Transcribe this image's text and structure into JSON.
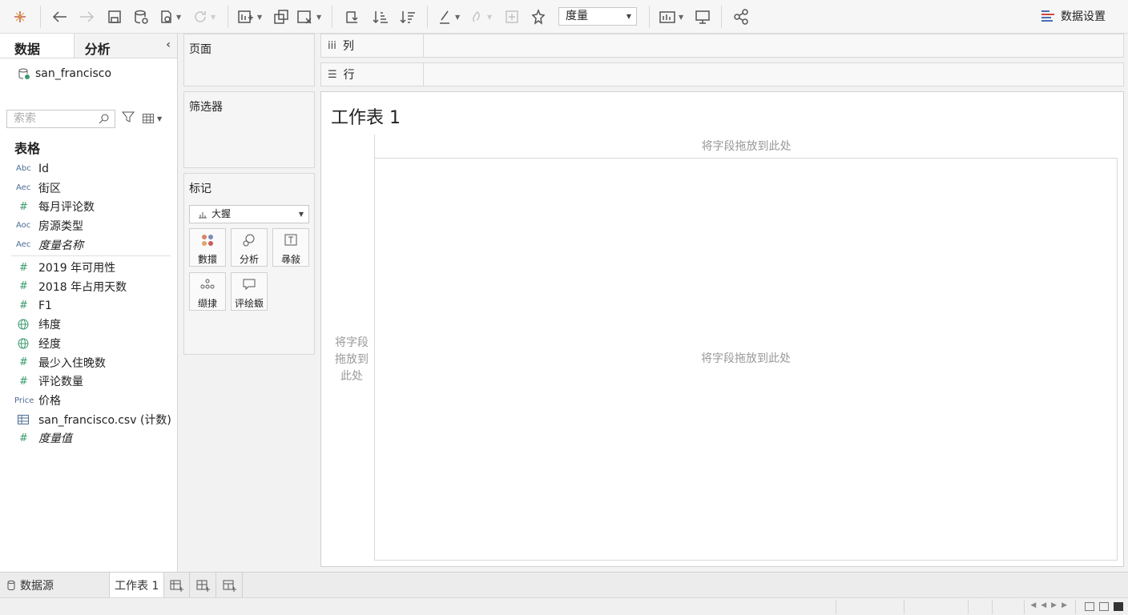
{
  "toolbar": {
    "measure_select": "度量",
    "data_settings": "数据设置"
  },
  "left_pane": {
    "tab_data": "数据",
    "tab_analysis": "分析",
    "datasource": "san_francisco",
    "search_placeholder": "索索",
    "section_title": "表格",
    "fields": [
      {
        "type": "Abc",
        "name": "Id"
      },
      {
        "type": "Aec",
        "name": "街区"
      },
      {
        "type": "#",
        "name": "每月评论数"
      },
      {
        "type": "Aoc",
        "name": "房源类型"
      },
      {
        "type": "Aec",
        "name": "度量名称"
      },
      {
        "type": "#",
        "name": "2019 年可用性"
      },
      {
        "type": "#",
        "name": "2018 年占用天数"
      },
      {
        "type": "#",
        "name": "F1"
      },
      {
        "type": "globe",
        "name": "纬度"
      },
      {
        "type": "globe",
        "name": "经度"
      },
      {
        "type": "#",
        "name": "最少入住晚数"
      },
      {
        "type": "#",
        "name": "评论数量"
      },
      {
        "type": "Price",
        "name": "价格"
      },
      {
        "type": "table",
        "name": "san_francisco.csv (计数)"
      },
      {
        "type": "#",
        "name": "度量值"
      }
    ]
  },
  "shelves": {
    "pages": "页面",
    "filters": "筛选器",
    "marks": "标记",
    "mark_type": "大握",
    "mark_buttons": [
      "數擐",
      "分析",
      "㝷敍",
      "缬捸",
      "评绘蝂"
    ],
    "columns": "列",
    "rows": "行"
  },
  "sheet": {
    "title": "工作表 1",
    "drop_top": "将字段拖放到此处",
    "drop_left": "将字段拖放到此处",
    "drop_main": "将字段拖放到此处"
  },
  "bottom": {
    "datasource_tab": "数据源",
    "sheet_tab": "工作表 1"
  }
}
